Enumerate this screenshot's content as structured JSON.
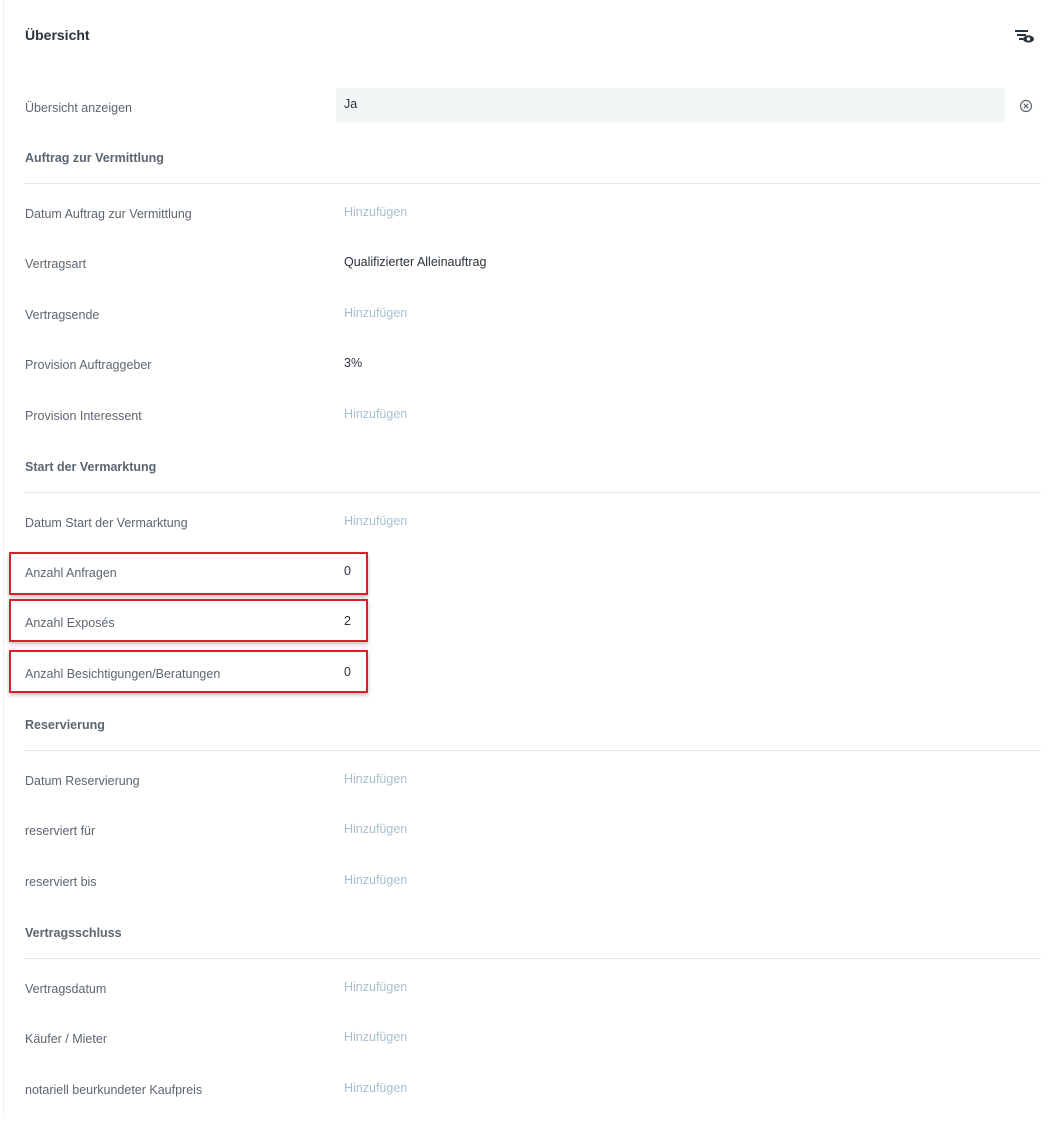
{
  "header": {
    "title": "Übersicht",
    "icon": "filter-eye-icon"
  },
  "overview": {
    "label": "Übersicht anzeigen",
    "value": "Ja",
    "clear_icon": "clear-circle-icon"
  },
  "placeholder": "Hinzufügen",
  "sections": {
    "auftrag": {
      "title": "Auftrag zur Vermittlung",
      "fields": {
        "datum": {
          "label": "Datum Auftrag zur Vermittlung",
          "value": "Hinzufügen"
        },
        "vertragsart": {
          "label": "Vertragsart",
          "value": "Qualifizierter Alleinauftrag"
        },
        "vertragsende": {
          "label": "Vertragsende",
          "value": "Hinzufügen"
        },
        "provision_auftraggeber": {
          "label": "Provision Auftraggeber",
          "value": "3%"
        },
        "provision_interessent": {
          "label": "Provision Interessent",
          "value": "Hinzufügen"
        }
      }
    },
    "vermarktung": {
      "title": "Start der Vermarktung",
      "fields": {
        "datum": {
          "label": "Datum Start der Vermarktung",
          "value": "Hinzufügen"
        },
        "anfragen": {
          "label": "Anzahl Anfragen",
          "value": "0"
        },
        "exposes": {
          "label": "Anzahl Exposés",
          "value": "2"
        },
        "besichtigungen": {
          "label": "Anzahl Besichtigungen/Beratungen",
          "value": "0"
        }
      }
    },
    "reservierung": {
      "title": "Reservierung",
      "fields": {
        "datum": {
          "label": "Datum Reservierung",
          "value": "Hinzufügen"
        },
        "reserviert_fuer": {
          "label": "reserviert für",
          "value": "Hinzufügen"
        },
        "reserviert_bis": {
          "label": "reserviert bis",
          "value": "Hinzufügen"
        }
      }
    },
    "vertragsschluss": {
      "title": "Vertragsschluss",
      "fields": {
        "vertragsdatum": {
          "label": "Vertragsdatum",
          "value": "Hinzufügen"
        },
        "kaeufer": {
          "label": "Käufer / Mieter",
          "value": "Hinzufügen"
        },
        "kaufpreis": {
          "label": "notariell beurkundeter Kaufpreis",
          "value": "Hinzufügen"
        }
      }
    }
  },
  "colors": {
    "highlight": "#d8202a",
    "placeholder": "#a9c0cf",
    "select_bg": "#f2f6f7"
  }
}
